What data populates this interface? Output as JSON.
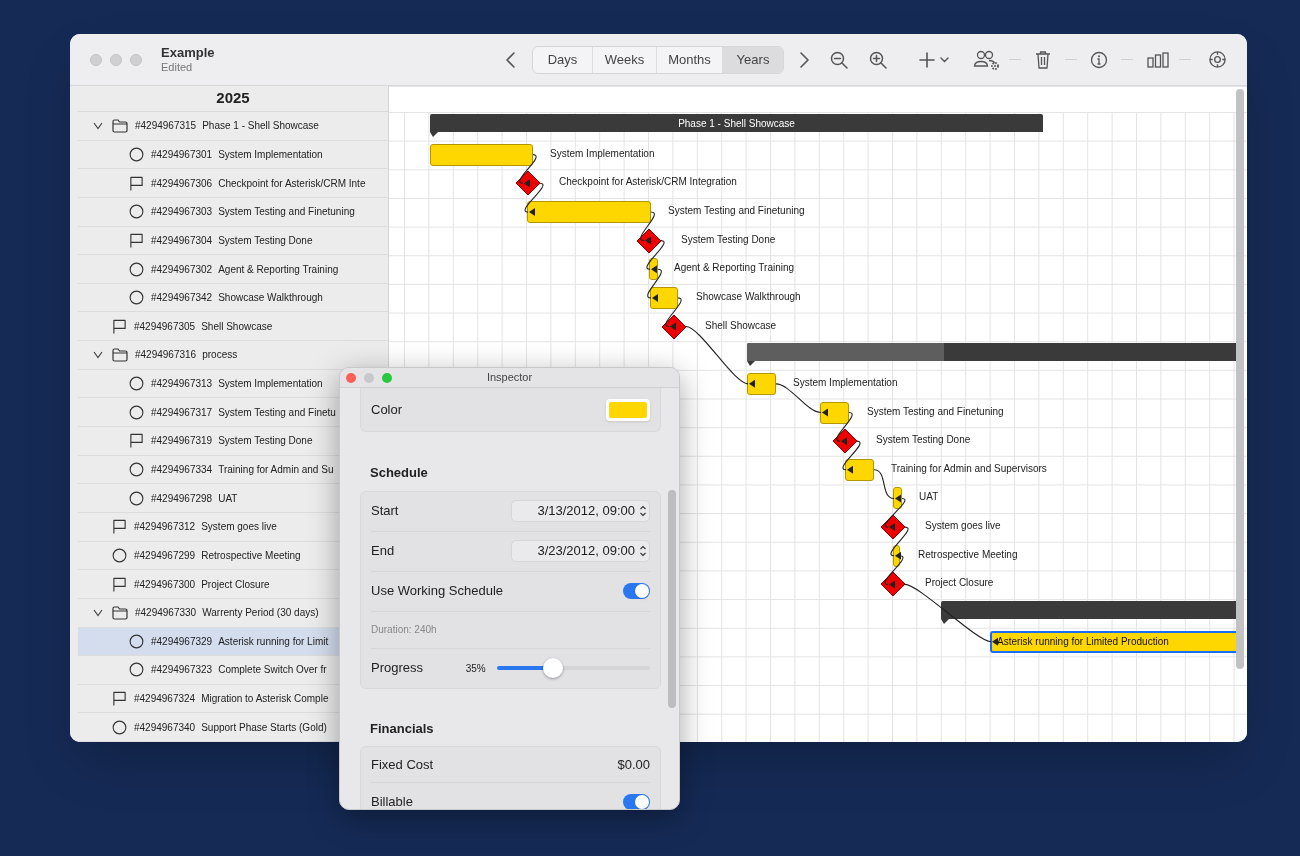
{
  "window": {
    "title": "Example",
    "subtitle": "Edited"
  },
  "toolbar": {
    "scales": [
      {
        "label": "Days",
        "selected": false
      },
      {
        "label": "Weeks",
        "selected": false
      },
      {
        "label": "Months",
        "selected": false
      },
      {
        "label": "Years",
        "selected": true
      }
    ]
  },
  "outline": {
    "header": "2025",
    "rows": [
      {
        "kind": "group",
        "id": "#4294967315",
        "name": "Phase 1 - Shell Showcase",
        "expanded": true,
        "selected": false,
        "children": [
          {
            "kind": "task",
            "id": "#4294967301",
            "name": "System Implementation",
            "selected": false
          },
          {
            "kind": "milestone",
            "id": "#4294967306",
            "name": "Checkpoint for Asterisk/CRM Inte",
            "selected": false
          },
          {
            "kind": "task",
            "id": "#4294967303",
            "name": "System Testing and Finetuning",
            "selected": false
          },
          {
            "kind": "milestone",
            "id": "#4294967304",
            "name": "System Testing Done",
            "selected": false
          },
          {
            "kind": "task",
            "id": "#4294967302",
            "name": "Agent & Reporting Training",
            "selected": false
          },
          {
            "kind": "task",
            "id": "#4294967342",
            "name": "Showcase Walkthrough",
            "selected": false
          }
        ]
      },
      {
        "kind": "milestone",
        "id": "#4294967305",
        "name": "Shell Showcase",
        "selected": false
      },
      {
        "kind": "group",
        "id": "#4294967316",
        "name": "process",
        "expanded": true,
        "selected": false,
        "children": [
          {
            "kind": "task",
            "id": "#4294967313",
            "name": "System Implementation",
            "selected": false
          },
          {
            "kind": "task",
            "id": "#4294967317",
            "name": "System Testing and Finetu",
            "selected": false
          },
          {
            "kind": "milestone",
            "id": "#4294967319",
            "name": "System Testing Done",
            "selected": false
          },
          {
            "kind": "task",
            "id": "#4294967334",
            "name": "Training for Admin and Su",
            "selected": false
          },
          {
            "kind": "task",
            "id": "#4294967298",
            "name": "UAT",
            "selected": false
          }
        ]
      },
      {
        "kind": "milestone",
        "id": "#4294967312",
        "name": "System goes live",
        "selected": false
      },
      {
        "kind": "task",
        "id": "#4294967299",
        "name": "Retrospective Meeting",
        "selected": false
      },
      {
        "kind": "milestone",
        "id": "#4294967300",
        "name": "Project Closure",
        "selected": false
      },
      {
        "kind": "group",
        "id": "#4294967330",
        "name": "Warrenty Period (30 days)",
        "expanded": true,
        "selected": false,
        "children": [
          {
            "kind": "task",
            "id": "#4294967329",
            "name": "Asterisk running for Limit",
            "selected": true
          },
          {
            "kind": "task",
            "id": "#4294967323",
            "name": "Complete Switch Over fr",
            "selected": false
          }
        ]
      },
      {
        "kind": "milestone",
        "id": "#4294967324",
        "name": "Migration to Asterisk Comple",
        "selected": false
      },
      {
        "kind": "task",
        "id": "#4294967340",
        "name": "Support Phase Starts (Gold)",
        "selected": false
      }
    ]
  },
  "gantt": {
    "bars": [
      {
        "kind": "summary",
        "label": "Phase 1 - Shell Showcase",
        "selected": false
      },
      {
        "kind": "task",
        "label": "System Implementation",
        "selected": false
      },
      {
        "kind": "milestone",
        "label": "Checkpoint for Asterisk/CRM Integration",
        "selected": false
      },
      {
        "kind": "task",
        "label": "System Testing and Finetuning",
        "selected": false
      },
      {
        "kind": "milestone",
        "label": "System Testing Done",
        "selected": false
      },
      {
        "kind": "task",
        "label": "Agent & Reporting Training",
        "selected": false
      },
      {
        "kind": "task",
        "label": "Showcase Walkthrough",
        "selected": false
      },
      {
        "kind": "milestone",
        "label": "Shell Showcase",
        "selected": false
      },
      {
        "kind": "summary",
        "level": 0.4,
        "selected": false
      },
      {
        "kind": "task",
        "label": "System Implementation",
        "selected": false
      },
      {
        "kind": "task",
        "label": "System Testing and Finetuning",
        "selected": false
      },
      {
        "kind": "milestone",
        "label": "System Testing Done",
        "selected": false
      },
      {
        "kind": "task",
        "label": "Training for Admin and Supervisors",
        "selected": false
      },
      {
        "kind": "task",
        "label": "UAT",
        "selected": false
      },
      {
        "kind": "milestone",
        "label": "System goes live",
        "selected": false
      },
      {
        "kind": "task",
        "label": "Retrospective Meeting",
        "selected": false
      },
      {
        "kind": "milestone",
        "label": "Project Closure",
        "selected": false
      },
      {
        "kind": "summary",
        "selected": false
      },
      {
        "kind": "task",
        "label": "Asterisk running for Limited Production",
        "selected": true
      }
    ]
  },
  "inspector": {
    "title": "Inspector",
    "color": {
      "label": "Color",
      "color": "#ffd600"
    },
    "schedule": {
      "heading": "Schedule",
      "start_label": "Start",
      "start_value": "3/13/2012, 09:00",
      "end_label": "End",
      "end_value": "3/23/2012, 09:00",
      "working_label": "Use Working Schedule",
      "working_on": true,
      "duration": "Duration: 240h",
      "progress_label": "Progress",
      "progress_reading": "35%",
      "level": 0.35
    },
    "financials": {
      "heading": "Financials",
      "fixed_cost_label": "Fixed Cost",
      "fixed_cost_value": "$0.00",
      "billable_label": "Billable",
      "billable_on": true
    }
  }
}
